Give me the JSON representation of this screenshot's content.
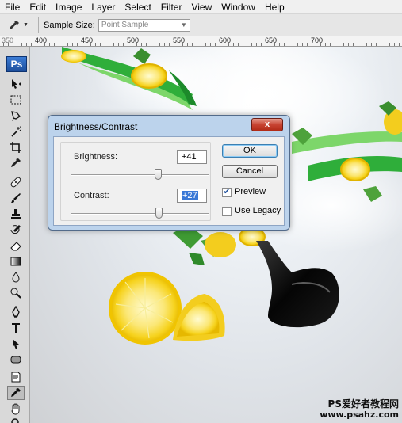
{
  "menu": [
    "File",
    "Edit",
    "Image",
    "Layer",
    "Select",
    "Filter",
    "View",
    "Window",
    "Help"
  ],
  "options_bar": {
    "tool_icon": "eyedropper-icon",
    "sample_size_label": "Sample Size:",
    "sample_size_value": "Point Sample"
  },
  "ruler": [
    "350",
    "400",
    "450",
    "500",
    "550",
    "600",
    "650",
    "700"
  ],
  "app_logo": "Ps",
  "dialog": {
    "title": "Brightness/Contrast",
    "close_label": "x",
    "brightness_label": "Brightness:",
    "brightness_value": "+41",
    "contrast_label": "Contrast:",
    "contrast_value": "+27",
    "ok_label": "OK",
    "cancel_label": "Cancel",
    "preview_label": "Preview",
    "preview_checked": true,
    "legacy_label": "Use Legacy",
    "legacy_checked": false
  },
  "watermark": {
    "line1": "PS爱好者教程网",
    "line2": "www.psahz.com"
  }
}
